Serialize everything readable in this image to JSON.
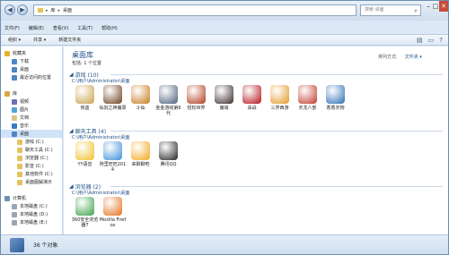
{
  "address": {
    "path": [
      "库",
      "桌面"
    ]
  },
  "search": {
    "placeholder": "搜索 桌面"
  },
  "menu": [
    "文件(F)",
    "编辑(E)",
    "查看(V)",
    "工具(T)",
    "帮助(H)"
  ],
  "toolbar": {
    "organize": "组织 ▾",
    "share": "共享 ▾",
    "new_folder": "新建文件夹"
  },
  "sidebar": {
    "items": [
      {
        "label": "收藏夹",
        "color": "#e8b22d"
      },
      {
        "label": "下载",
        "color": "#4e86c6"
      },
      {
        "label": "桌面",
        "color": "#4e86c6"
      },
      {
        "label": "最近访问的位置",
        "color": "#4e86c6"
      },
      {
        "label": "",
        "color": ""
      },
      {
        "label": "库",
        "color": "#d9a640"
      },
      {
        "label": "视频",
        "color": "#6b6fb7"
      },
      {
        "label": "图片",
        "color": "#54a0d6"
      },
      {
        "label": "文档",
        "color": "#d9c58a"
      },
      {
        "label": "音乐",
        "color": "#3d7cc6"
      },
      {
        "label": "桌面",
        "color": "#4e86c6",
        "selected": true
      },
      {
        "label": "游戏 (C:)",
        "color": "#e6c35a"
      },
      {
        "label": "聊天工具 (C:)",
        "color": "#e6c35a"
      },
      {
        "label": "浏览器 (C:)",
        "color": "#e6c35a"
      },
      {
        "label": "影音 (C:)",
        "color": "#e6c35a"
      },
      {
        "label": "其他软件 (C:)",
        "color": "#e6c35a"
      },
      {
        "label": "桌面图解演示",
        "color": "#e6c35a"
      },
      {
        "label": "",
        "color": ""
      },
      {
        "label": "计算机",
        "color": "#6f8fb5"
      },
      {
        "label": "本地磁盘 (C:)",
        "color": "#9aa5b2"
      },
      {
        "label": "本地磁盘 (D:)",
        "color": "#9aa5b2"
      },
      {
        "label": "本地磁盘 (E:)",
        "color": "#9aa5b2"
      }
    ]
  },
  "library": {
    "title": "桌面库",
    "subtitle": "包括: 1 个位置",
    "arrange_label": "排列方式:",
    "arrange_value": "文件夹 ▾"
  },
  "groups": [
    {
      "title": "游戏 (10)",
      "path": "C:\\用户\\Administrator\\桌面",
      "items": [
        {
          "label": "侠盗",
          "color": "#c8a24a"
        },
        {
          "label": "仙剑之神魔录",
          "color": "#6b3f1c"
        },
        {
          "label": "斗仙",
          "color": "#c77c1e"
        },
        {
          "label": "金金游戏第6代",
          "color": "#4a5f7a"
        },
        {
          "label": "轻松世界",
          "color": "#b03a1e"
        },
        {
          "label": "魔域",
          "color": "#3a2a2a"
        },
        {
          "label": "诛战",
          "color": "#b3121b"
        },
        {
          "label": "三界西游",
          "color": "#e59a28"
        },
        {
          "label": "天龙八部",
          "color": "#c0392b"
        },
        {
          "label": "香香天物",
          "color": "#2a6fb5"
        }
      ]
    },
    {
      "title": "聊天工具 (4)",
      "path": "C:\\用户\\Administrator\\桌面",
      "items": [
        {
          "label": "YY语音",
          "color": "#f0c02a"
        },
        {
          "label": "阿里旺旺2014",
          "color": "#3c8fd8"
        },
        {
          "label": "来聊聊吧",
          "color": "#f2a81e"
        },
        {
          "label": "腾讯QQ",
          "color": "#222222"
        }
      ]
    },
    {
      "title": "浏览器 (2)",
      "path": "C:\\用户\\Administrator\\桌面",
      "items": [
        {
          "label": "360安全浏览器7",
          "color": "#3aa14b"
        },
        {
          "label": "Mozilla Firefox",
          "color": "#e5701c"
        }
      ]
    }
  ],
  "status": {
    "count": "36 个对象"
  }
}
